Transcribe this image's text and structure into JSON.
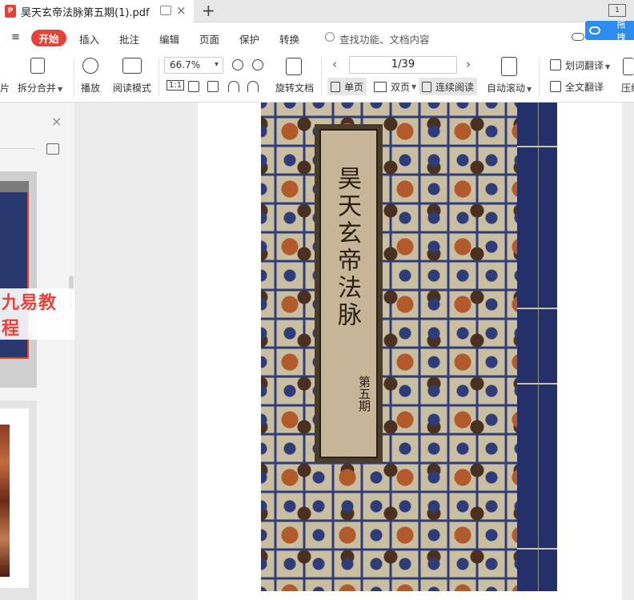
{
  "tab": {
    "title": "昊天玄帝法脉第五期(1).pdf",
    "pdf_badge": "P",
    "close_glyph": "×",
    "new_tab_glyph": "+",
    "window_badge": "1"
  },
  "menu": {
    "left_glyph": "≡",
    "items": [
      "开始",
      "插入",
      "批注",
      "编辑",
      "页面",
      "保护",
      "转换"
    ],
    "search_placeholder": "查找功能、文档内容",
    "sync_label": "拖拽"
  },
  "toolbar": {
    "partial_left_label": "片",
    "split_merge": "拆分合并",
    "play": "播放",
    "read_mode": "阅读模式",
    "zoom": "66.7%",
    "actual_size": "1:1",
    "rotate_doc": "旋转文档",
    "page_indicator": "1/39",
    "single_page": "单页",
    "double_page": "双页",
    "continuous": "连续阅读",
    "auto_scroll": "自动滚动",
    "word_translate": "划词翻译",
    "full_translate": "全文翻译",
    "compress": "压缩"
  },
  "sidebar": {
    "close_glyph": "×",
    "watermark": "九易教程"
  },
  "document": {
    "cover_title": "昊天玄帝法脉",
    "cover_subtitle": "第五期"
  }
}
